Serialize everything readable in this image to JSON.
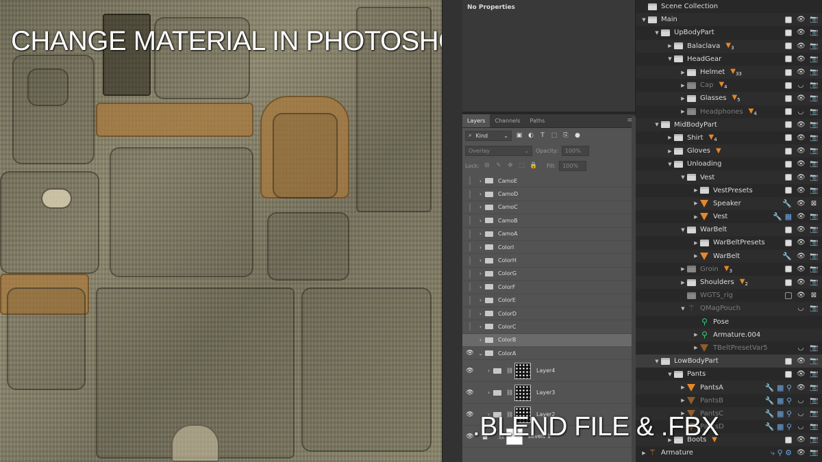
{
  "overlay": {
    "title": "CHANGE MATERIAL IN PHOTOSHOP",
    "caption": ".BLEND FILE & .FBX"
  },
  "photoshop": {
    "properties_title": "No Properties",
    "tabs": [
      {
        "label": "Layers",
        "active": true
      },
      {
        "label": "Channels",
        "active": false
      },
      {
        "label": "Paths",
        "active": false
      }
    ],
    "filter_kind": "Kind",
    "blend_mode": "Overlay",
    "opacity_label": "Opacity:",
    "opacity_value": "100%",
    "lock_label": "Lock:",
    "fill_label": "Fill:",
    "fill_value": "100%",
    "layers": [
      {
        "name": "CamoE",
        "visible": false,
        "type": "group",
        "selected": false
      },
      {
        "name": "CamoD",
        "visible": false,
        "type": "group",
        "selected": false
      },
      {
        "name": "CamoC",
        "visible": false,
        "type": "group",
        "selected": false
      },
      {
        "name": "CamoB",
        "visible": false,
        "type": "group",
        "selected": false
      },
      {
        "name": "CamoA",
        "visible": false,
        "type": "group",
        "selected": false
      },
      {
        "name": "ColorI",
        "visible": false,
        "type": "group",
        "selected": false
      },
      {
        "name": "ColorH",
        "visible": false,
        "type": "group",
        "selected": false
      },
      {
        "name": "ColorG",
        "visible": false,
        "type": "group",
        "selected": false
      },
      {
        "name": "ColorF",
        "visible": false,
        "type": "group",
        "selected": false
      },
      {
        "name": "ColorE",
        "visible": false,
        "type": "group",
        "selected": false
      },
      {
        "name": "ColorD",
        "visible": false,
        "type": "group",
        "selected": false
      },
      {
        "name": "ColorC",
        "visible": false,
        "type": "group",
        "selected": false
      },
      {
        "name": "ColorB",
        "visible": false,
        "type": "group",
        "selected": true
      },
      {
        "name": "ColorA",
        "visible": true,
        "type": "group-open",
        "selected": false
      },
      {
        "name": "Layer4",
        "visible": true,
        "type": "layer",
        "selected": false
      },
      {
        "name": "Layer3",
        "visible": true,
        "type": "layer",
        "selected": false
      },
      {
        "name": "Layer2",
        "visible": true,
        "type": "layer",
        "selected": false
      },
      {
        "name": "Levels 1",
        "visible": true,
        "type": "adjust",
        "selected": false
      }
    ]
  },
  "outliner": {
    "rows": [
      {
        "name": "Scene Collection",
        "depth": 0,
        "icon": "coll",
        "expander": "",
        "dim": false,
        "badge": "",
        "badge_num": "",
        "mods": "",
        "checkbox": "none",
        "eye": "",
        "cam": ""
      },
      {
        "name": "Main",
        "depth": 0,
        "icon": "coll",
        "expander": "▼",
        "dim": false,
        "badge": "",
        "badge_num": "",
        "mods": "",
        "checkbox": "on",
        "eye": "👁",
        "cam": "📷"
      },
      {
        "name": "UpBodyPart",
        "depth": 1,
        "icon": "coll",
        "expander": "▼",
        "dim": false,
        "badge": "",
        "badge_num": "",
        "mods": "",
        "checkbox": "on",
        "eye": "👁",
        "cam": "📷"
      },
      {
        "name": "Balaclava",
        "depth": 2,
        "icon": "coll",
        "expander": "▶",
        "dim": false,
        "badge": "▼",
        "badge_num": "3",
        "mods": "",
        "checkbox": "on",
        "eye": "👁",
        "cam": "📷"
      },
      {
        "name": "HeadGear",
        "depth": 2,
        "icon": "coll",
        "expander": "▼",
        "dim": false,
        "badge": "",
        "badge_num": "",
        "mods": "",
        "checkbox": "on",
        "eye": "👁",
        "cam": "📷"
      },
      {
        "name": "Helmet",
        "depth": 3,
        "icon": "coll",
        "expander": "▶",
        "dim": false,
        "badge": "▼",
        "badge_num": "33",
        "mods": "",
        "checkbox": "on",
        "eye": "👁",
        "cam": "📷"
      },
      {
        "name": "Cap",
        "depth": 3,
        "icon": "coll",
        "expander": "▶",
        "dim": true,
        "badge": "▼",
        "badge_num": "4",
        "mods": "",
        "checkbox": "on",
        "eye": "◡",
        "cam": "📷"
      },
      {
        "name": "Glasses",
        "depth": 3,
        "icon": "coll",
        "expander": "▶",
        "dim": false,
        "badge": "▼",
        "badge_num": "5",
        "mods": "",
        "checkbox": "on",
        "eye": "👁",
        "cam": "📷"
      },
      {
        "name": "Headphones",
        "depth": 3,
        "icon": "coll",
        "expander": "▶",
        "dim": true,
        "badge": "▼",
        "badge_num": "4",
        "mods": "",
        "checkbox": "on",
        "eye": "◡",
        "cam": "📷"
      },
      {
        "name": "MidBodyPart",
        "depth": 1,
        "icon": "coll",
        "expander": "▼",
        "dim": false,
        "badge": "",
        "badge_num": "",
        "mods": "",
        "checkbox": "on",
        "eye": "👁",
        "cam": "📷"
      },
      {
        "name": "Shirt",
        "depth": 2,
        "icon": "coll",
        "expander": "▶",
        "dim": false,
        "badge": "▼",
        "badge_num": "4",
        "mods": "",
        "checkbox": "on",
        "eye": "👁",
        "cam": "📷"
      },
      {
        "name": "Gloves",
        "depth": 2,
        "icon": "coll",
        "expander": "▶",
        "dim": false,
        "badge": "▼",
        "badge_num": "",
        "mods": "",
        "checkbox": "on",
        "eye": "👁",
        "cam": "📷"
      },
      {
        "name": "Unloading",
        "depth": 2,
        "icon": "coll",
        "expander": "▼",
        "dim": false,
        "badge": "",
        "badge_num": "",
        "mods": "",
        "checkbox": "on",
        "eye": "👁",
        "cam": "📷"
      },
      {
        "name": "Vest",
        "depth": 3,
        "icon": "coll",
        "expander": "▼",
        "dim": false,
        "badge": "",
        "badge_num": "",
        "mods": "",
        "checkbox": "on",
        "eye": "👁",
        "cam": "📷"
      },
      {
        "name": "VestPresets",
        "depth": 4,
        "icon": "coll",
        "expander": "▶",
        "dim": false,
        "badge": "",
        "badge_num": "",
        "mods": "",
        "checkbox": "on",
        "eye": "👁",
        "cam": "📷"
      },
      {
        "name": "Speaker",
        "depth": 4,
        "icon": "mesh",
        "expander": "▶",
        "dim": false,
        "badge": "",
        "badge_num": "",
        "mods": "🔧",
        "checkbox": "none",
        "eye": "👁",
        "cam": "⊠"
      },
      {
        "name": "Vest",
        "depth": 4,
        "icon": "mesh",
        "expander": "▶",
        "dim": false,
        "badge": "",
        "badge_num": "",
        "mods": "🔧 ▦",
        "checkbox": "none",
        "eye": "👁",
        "cam": "📷"
      },
      {
        "name": "WarBelt",
        "depth": 3,
        "icon": "coll",
        "expander": "▼",
        "dim": false,
        "badge": "",
        "badge_num": "",
        "mods": "",
        "checkbox": "on",
        "eye": "👁",
        "cam": "📷"
      },
      {
        "name": "WarBeltPresets",
        "depth": 4,
        "icon": "coll",
        "expander": "▶",
        "dim": false,
        "badge": "",
        "badge_num": "",
        "mods": "",
        "checkbox": "on",
        "eye": "👁",
        "cam": "📷"
      },
      {
        "name": "WarBelt",
        "depth": 4,
        "icon": "mesh",
        "expander": "▶",
        "dim": false,
        "badge": "",
        "badge_num": "",
        "mods": "🔧",
        "checkbox": "none",
        "eye": "👁",
        "cam": "📷"
      },
      {
        "name": "Groin",
        "depth": 3,
        "icon": "coll",
        "expander": "▶",
        "dim": true,
        "badge": "▼",
        "badge_num": "3",
        "mods": "",
        "checkbox": "on",
        "eye": "👁",
        "cam": "📷"
      },
      {
        "name": "Shoulders",
        "depth": 3,
        "icon": "coll",
        "expander": "▶",
        "dim": false,
        "badge": "▼",
        "badge_num": "2",
        "mods": "",
        "checkbox": "on",
        "eye": "👁",
        "cam": "📷"
      },
      {
        "name": "WGTS_rig",
        "depth": 3,
        "icon": "coll",
        "expander": "",
        "dim": true,
        "badge": "",
        "badge_num": "",
        "mods": "",
        "checkbox": "off",
        "eye": "👁",
        "cam": "⊠"
      },
      {
        "name": "QMagPouch",
        "depth": 3,
        "icon": "arm",
        "expander": "▼",
        "dim": true,
        "badge": "",
        "badge_num": "",
        "mods": "",
        "checkbox": "none",
        "eye": "◡",
        "cam": "📷"
      },
      {
        "name": "Pose",
        "depth": 4,
        "icon": "bone",
        "expander": "",
        "dim": false,
        "badge": "",
        "badge_num": "",
        "mods": "",
        "checkbox": "none",
        "eye": "",
        "cam": ""
      },
      {
        "name": "Armature.004",
        "depth": 4,
        "icon": "bone",
        "expander": "▶",
        "dim": false,
        "badge": "",
        "badge_num": "",
        "mods": "",
        "checkbox": "none",
        "eye": "",
        "cam": ""
      },
      {
        "name": "TBeltPresetVar5",
        "depth": 4,
        "icon": "mesh",
        "expander": "▶",
        "dim": true,
        "badge": "",
        "badge_num": "",
        "mods": "",
        "checkbox": "none",
        "eye": "◡",
        "cam": "📷"
      },
      {
        "name": "LowBodyPart",
        "depth": 1,
        "icon": "coll",
        "expander": "▼",
        "dim": false,
        "badge": "",
        "badge_num": "",
        "mods": "",
        "checkbox": "on",
        "eye": "👁",
        "cam": "📷",
        "active": true
      },
      {
        "name": "Pants",
        "depth": 2,
        "icon": "coll",
        "expander": "▼",
        "dim": false,
        "badge": "",
        "badge_num": "",
        "mods": "",
        "checkbox": "on",
        "eye": "👁",
        "cam": "📷"
      },
      {
        "name": "PantsA",
        "depth": 3,
        "icon": "mesh",
        "expander": "▶",
        "dim": false,
        "badge": "",
        "badge_num": "",
        "mods": "🔧 ▦ ⚲",
        "checkbox": "none",
        "eye": "👁",
        "cam": "📷"
      },
      {
        "name": "PantsB",
        "depth": 3,
        "icon": "mesh",
        "expander": "▶",
        "dim": true,
        "badge": "",
        "badge_num": "",
        "mods": "🔧 ▦ ⚲",
        "checkbox": "none",
        "eye": "◡",
        "cam": "📷"
      },
      {
        "name": "PantsC",
        "depth": 3,
        "icon": "mesh",
        "expander": "▶",
        "dim": true,
        "badge": "",
        "badge_num": "",
        "mods": "🔧 ▦ ⚲",
        "checkbox": "none",
        "eye": "◡",
        "cam": "📷"
      },
      {
        "name": "PantsD",
        "depth": 3,
        "icon": "mesh",
        "expander": "▶",
        "dim": true,
        "badge": "",
        "badge_num": "",
        "mods": "🔧 ▦ ⚲",
        "checkbox": "none",
        "eye": "◡",
        "cam": "📷"
      },
      {
        "name": "Boots",
        "depth": 2,
        "icon": "coll",
        "expander": "▶",
        "dim": false,
        "badge": "▼",
        "badge_num": "",
        "mods": "",
        "checkbox": "on",
        "eye": "👁",
        "cam": "📷"
      },
      {
        "name": "Armature",
        "depth": 0,
        "icon": "arm",
        "expander": "▶",
        "dim": false,
        "badge": "",
        "badge_num": "",
        "mods": "⤷ ⚲ ⚙",
        "checkbox": "none",
        "eye": "👁",
        "cam": "📷"
      }
    ]
  }
}
